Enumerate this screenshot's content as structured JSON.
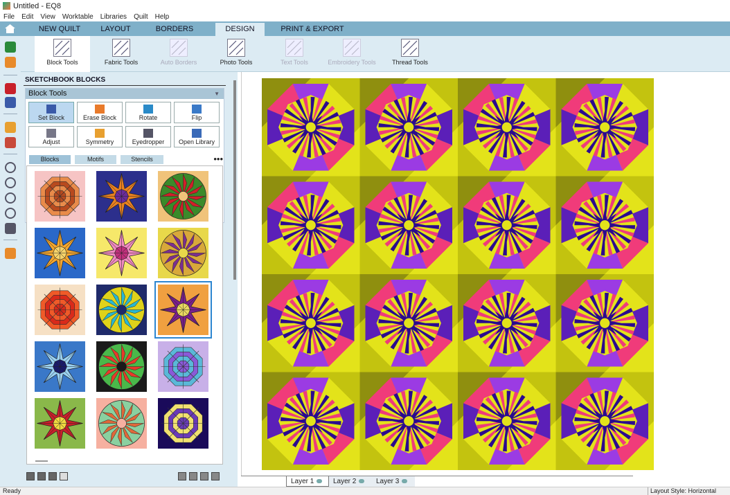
{
  "window": {
    "title": "Untitled - EQ8"
  },
  "menu": [
    "File",
    "Edit",
    "View",
    "Worktable",
    "Libraries",
    "Quilt",
    "Help"
  ],
  "tabs": [
    {
      "label": "NEW QUILT"
    },
    {
      "label": "LAYOUT"
    },
    {
      "label": "BORDERS"
    },
    {
      "label": "DESIGN",
      "active": true
    },
    {
      "label": "PRINT & EXPORT"
    }
  ],
  "ribbon": [
    {
      "label": "Block Tools",
      "icon": "block-tools-icon",
      "active": true
    },
    {
      "label": "Fabric Tools",
      "icon": "fabric-tools-icon"
    },
    {
      "label": "Auto Borders",
      "icon": "auto-borders-icon",
      "disabled": true
    },
    {
      "label": "Photo Tools",
      "icon": "photo-tools-icon"
    },
    {
      "label": "Text Tools",
      "icon": "text-tools-icon",
      "disabled": true
    },
    {
      "label": "Embroidery Tools",
      "icon": "embroidery-tools-icon",
      "disabled": true
    },
    {
      "label": "Thread Tools",
      "icon": "thread-tools-icon"
    }
  ],
  "sidebar_icons": [
    "home-icon",
    "add-to-project-icon",
    "open-file-icon",
    "print-icon",
    "notes-icon",
    "pencil-icon",
    "undo-icon",
    "zoom-in-icon",
    "zoom-out-icon",
    "fit-to-worktable-icon",
    "refresh-view-icon",
    "help-icon",
    "settings-icon"
  ],
  "panel": {
    "title": "SKETCHBOOK BLOCKS",
    "block_tools": {
      "header": "Block Tools",
      "tools": [
        {
          "label": "Set Block",
          "icon": "set-block-icon",
          "selected": true
        },
        {
          "label": "Erase Block",
          "icon": "erase-block-icon"
        },
        {
          "label": "Rotate",
          "icon": "rotate-icon"
        },
        {
          "label": "Flip",
          "icon": "flip-icon"
        },
        {
          "label": "Adjust",
          "icon": "adjust-icon"
        },
        {
          "label": "Symmetry",
          "icon": "symmetry-icon"
        },
        {
          "label": "Eyedropper",
          "icon": "eyedropper-icon"
        },
        {
          "label": "Open Library",
          "icon": "open-library-icon"
        }
      ]
    },
    "subtabs": [
      {
        "label": "Blocks",
        "active": true
      },
      {
        "label": "Motifs"
      },
      {
        "label": "Stencils"
      }
    ],
    "more_label": "•••",
    "selected_block": 9,
    "blocks": [
      {
        "bg": "#f6c4c4",
        "c1": "#b84a1e",
        "c2": "#e98b4a",
        "style": "web"
      },
      {
        "bg": "#2c2f8c",
        "c1": "#e98120",
        "c2": "#6a2b9b",
        "style": "star"
      },
      {
        "bg": "#f0c37a",
        "c1": "#d11f2a",
        "c2": "#3b8a2a",
        "style": "mandala"
      },
      {
        "bg": "#2a68c8",
        "c1": "#f2a630",
        "c2": "#f6d36a",
        "style": "star"
      },
      {
        "bg": "#f6e86a",
        "c1": "#f08ac0",
        "c2": "#c0307c",
        "style": "star"
      },
      {
        "bg": "#e8d84a",
        "c1": "#7b2e90",
        "c2": "#d8a83a",
        "style": "mandala"
      },
      {
        "bg": "#f6e0c4",
        "c1": "#d92a1a",
        "c2": "#f05a28",
        "style": "web"
      },
      {
        "bg": "#1f2a6a",
        "c1": "#2ab8d0",
        "c2": "#e0d21a",
        "style": "mandala"
      },
      {
        "bg": "#f0a040",
        "c1": "#7a1f8c",
        "c2": "#e8d860",
        "style": "star"
      },
      {
        "bg": "#3a78c8",
        "c1": "#9ad0f0",
        "c2": "#1a1a6a",
        "style": "star"
      },
      {
        "bg": "#1a1a1a",
        "c1": "#e83a2a",
        "c2": "#4ab84a",
        "style": "mandala"
      },
      {
        "bg": "#c8b0e8",
        "c1": "#8a5ad8",
        "c2": "#5ab8d8",
        "style": "web"
      },
      {
        "bg": "#8ab84a",
        "c1": "#c8202a",
        "c2": "#f0d840",
        "style": "star"
      },
      {
        "bg": "#f6b0a0",
        "c1": "#e0683a",
        "c2": "#8ad0a0",
        "style": "mandala"
      },
      {
        "bg": "#1a0a5a",
        "c1": "#6a3ab8",
        "c2": "#f0e070",
        "style": "web"
      }
    ]
  },
  "layers": [
    {
      "label": "Layer 1",
      "active": true
    },
    {
      "label": "Layer 2"
    },
    {
      "label": "Layer 3"
    }
  ],
  "quilt": {
    "rows": 4,
    "cols": 4,
    "colors": {
      "background": "#c3c30f",
      "yellow": "#e3e31a",
      "olive": "#8f8f0f",
      "purple": "#5b1fb8",
      "violet": "#9b3be3",
      "pink": "#f03b7a",
      "deep": "#2b0a8f"
    }
  },
  "status": {
    "left": "Ready",
    "right": "Layout Style: Horizontal"
  }
}
